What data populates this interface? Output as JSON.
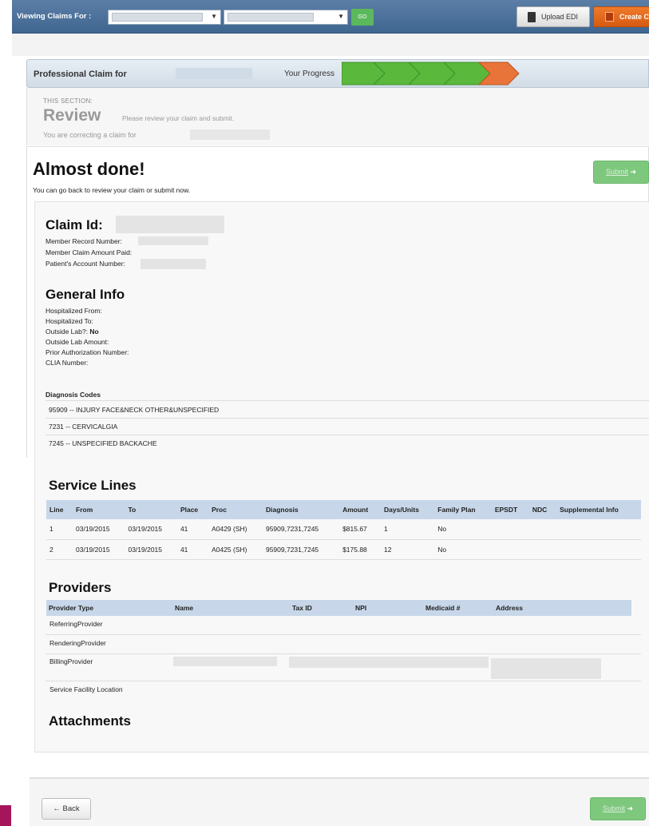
{
  "topbar": {
    "viewing_label": "Viewing Claims For :",
    "go_label": "GO",
    "upload_label": "Upload EDI",
    "create_label": "Create Claim",
    "upload_icon": "file-icon",
    "create_icon": "new-claim-icon"
  },
  "progress": {
    "title": "Professional Claim for",
    "label": "Your Progress",
    "steps_total": 5,
    "steps_completed": 4,
    "completed_color": "#5ab83c",
    "current_color": "#e8743a"
  },
  "section": {
    "this_section": "THIS SECTION:",
    "name": "Review",
    "description": "Please review your claim and submit.",
    "correcting": "You are correcting a claim for"
  },
  "main": {
    "heading": "Almost done!",
    "subheading": "You can go back to review your claim or submit now.",
    "submit_label": "Submit"
  },
  "claim": {
    "heading": "Claim Id:",
    "fields": [
      "Member Record Number:",
      "Member Claim Amount Paid:",
      "Patient's Account Number:"
    ]
  },
  "general": {
    "heading": "General Info",
    "hospitalized_from": "Hospitalized From:",
    "hospitalized_to": "Hospitalized To:",
    "outside_lab_label": "Outside Lab?:",
    "outside_lab_value": "No",
    "outside_lab_amount": "Outside Lab Amount:",
    "prior_auth": "Prior Authorization Number:",
    "clia": "CLIA Number:"
  },
  "diagnosis": {
    "heading": "Diagnosis Codes",
    "codes": [
      "95909 -- INJURY FACE&NECK OTHER&UNSPECIFIED",
      "7231 -- CERVICALGIA",
      "7245 -- UNSPECIFIED BACKACHE"
    ]
  },
  "service_lines": {
    "heading": "Service Lines",
    "columns": [
      "Line",
      "From",
      "To",
      "Place",
      "Proc",
      "Diagnosis",
      "Amount",
      "Days/Units",
      "Family Plan",
      "EPSDT",
      "NDC",
      "Supplemental Info"
    ],
    "rows": [
      [
        "1",
        "03/19/2015",
        "03/19/2015",
        "41",
        "A0429 (SH)",
        "95909,7231,7245",
        "$815.67",
        "1",
        "No",
        "",
        "",
        ""
      ],
      [
        "2",
        "03/19/2015",
        "03/19/2015",
        "41",
        "A0425 (SH)",
        "95909,7231,7245",
        "$175.88",
        "12",
        "No",
        "",
        "",
        ""
      ]
    ]
  },
  "providers": {
    "heading": "Providers",
    "columns": [
      "Provider Type",
      "Name",
      "Tax ID",
      "NPI",
      "Medicaid #",
      "Address"
    ],
    "rows": [
      "ReferringProvider",
      "RenderingProvider",
      "BillingProvider",
      "Service Facility Location"
    ]
  },
  "attachments": {
    "heading": "Attachments"
  },
  "footer": {
    "back_label": "Back",
    "submit_label": "Submit"
  }
}
